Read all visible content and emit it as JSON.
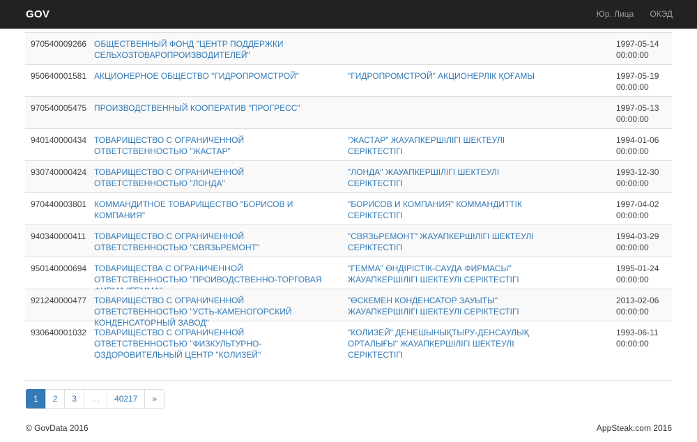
{
  "navbar": {
    "brand": "GOV",
    "links": [
      "Юр. Лица",
      "ОКЭД"
    ]
  },
  "rows": [
    {
      "id": "970540009266",
      "name_ru": "ОБЩЕСТВЕННЫЙ ФОНД \"ЦЕНТР ПОДДЕРЖКИ СЕЛЬХОЗТОВАРОПРОИЗВОДИТЕЛЕЙ\"",
      "name_kz": "",
      "date": "1997-05-14",
      "time": "00:00:00"
    },
    {
      "id": "950640001581",
      "name_ru": "АКЦИОНЕРНОЕ ОБЩЕСТВО \"ГИДРОПРОМСТРОЙ\"",
      "name_kz": "\"ГИДРОПРОМСТРОЙ\" АКЦИОНЕРЛІК ҚОҒАМЫ",
      "date": "1997-05-19",
      "time": "00:00:00"
    },
    {
      "id": "970540005475",
      "name_ru": "ПРОИЗВОДСТВЕННЫЙ КООПЕРАТИВ \"ПРОГРЕСС\"",
      "name_kz": "",
      "date": "1997-05-13",
      "time": "00:00:00"
    },
    {
      "id": "940140000434",
      "name_ru": "ТОВАРИЩЕСТВО С ОГРАНИЧЕННОЙ ОТВЕТСТВЕННОСТЬЮ \"ЖАСТАР\"",
      "name_kz": "\"ЖАСТАР\" ЖАУАПКЕРШІЛІГІ ШЕКТЕУЛІ СЕРІКТЕСТІГІ",
      "date": "1994-01-06",
      "time": "00:00:00"
    },
    {
      "id": "930740000424",
      "name_ru": "ТОВАРИЩЕСТВО С ОГРАНИЧЕННОЙ ОТВЕТСТВЕННОСТЬЮ \"ЛОНДА\"",
      "name_kz": "\"ЛОНДА\" ЖАУАПКЕРШІЛІГІ ШЕКТЕУЛІ СЕРІКТЕСТІГІ",
      "date": "1993-12-30",
      "time": "00:00:00"
    },
    {
      "id": "970440003801",
      "name_ru": "КОММАНДИТНОЕ ТОВАРИЩЕСТВО \"БОРИСОВ И КОМПАНИЯ\"",
      "name_kz": "\"БОРИСОВ И КОМПАНИЯ\" КОММАНДИТТІК СЕРІКТЕСТІГІ",
      "date": "1997-04-02",
      "time": "00:00:00"
    },
    {
      "id": "940340000411",
      "name_ru": "ТОВАРИЩЕСТВО С ОГРАНИЧЕННОЙ ОТВЕТСТВЕННОСТЬЮ \"СВЯЗЬРЕМОНТ\"",
      "name_kz": "\"СВЯЗЬРЕМОНТ\" ЖАУАПКЕРШІЛІГІ ШЕКТЕУЛІ СЕРІКТЕСТІГІ",
      "date": "1994-03-29",
      "time": "00:00:00"
    },
    {
      "id": "950140000694",
      "name_ru": "ТОВАРИЩЕСТВА С ОГРАНИЧЕННОЙ ОТВЕТСТВЕННОСТЬЮ \"ПРОИВОДСТВЕННО-ТОРГОВАЯ ФИРМА \"ГЕММА\"",
      "name_kz": "\"ГЕММА\" ӨНДІРІСТІК-САУДА ФИРМАСЫ\" ЖАУАПКЕРШІЛІГІ ШЕКТЕУЛІ СЕРІКТЕСТІГІ",
      "date": "1995-01-24",
      "time": "00:00:00"
    },
    {
      "id": "921240000477",
      "name_ru": "ТОВАРИЩЕСТВО С ОГРАНИЧЕННОЙ ОТВЕТСТВЕННОСТЬЮ \"УСТЬ-КАМЕНОГОРСКИЙ КОНДЕНСАТОРНЫЙ ЗАВОД\"",
      "name_kz": "\"ӨСКЕМЕН КОНДЕНСАТОР ЗАУЫТЫ\" ЖАУАПКЕРШІЛІГІ ШЕКТЕУЛІ СЕРІКТЕСТІГІ",
      "date": "2013-02-06",
      "time": "00:00:00"
    },
    {
      "id": "930640001032",
      "name_ru": "ТОВАРИЩЕСТВО С ОГРАНИЧЕННОЙ ОТВЕТСТВЕННОСТЬЮ \"ФИЗКУЛЬТУРНО-ОЗДОРОВИТЕЛЬНЫЙ ЦЕНТР \"КОЛИЗЕЙ\"",
      "name_kz": "\"КОЛИЗЕЙ\" ДЕНЕШЫНЫҚТЫРУ-ДЕНСАУЛЫҚ ОРТАЛЫҒЫ\" ЖАУАПКЕРШІЛІГІ ШЕКТЕУЛІ СЕРІКТЕСТІГІ",
      "date": "1993-06-11",
      "time": "00:00:00"
    }
  ],
  "pagination": {
    "pages": [
      "1",
      "2",
      "3",
      "…",
      "40217",
      "»"
    ],
    "active": "1"
  },
  "footer": {
    "left": "© GovData 2016",
    "right": "AppSteak.com 2016"
  },
  "colors": {
    "navbar_bg": "#222222",
    "link": "#337ab7",
    "active_page": "#337ab7",
    "stripe": "#f9f9f9"
  }
}
